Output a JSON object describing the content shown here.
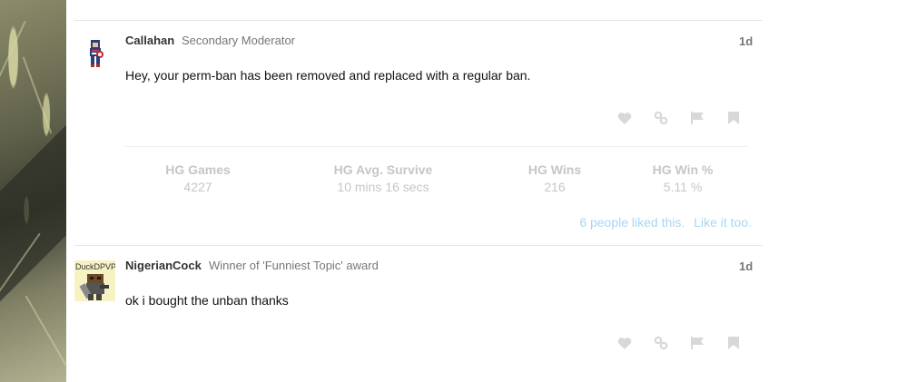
{
  "posts": [
    {
      "author": "Callahan",
      "user_title": "Secondary Moderator",
      "date": "1d",
      "body": "Hey, your perm-ban has been removed and replaced with a regular ban.",
      "stats": [
        {
          "label": "HG Games",
          "value": "4227"
        },
        {
          "label": "HG Avg. Survive",
          "value": "10 mins 16 secs"
        },
        {
          "label": "HG Wins",
          "value": "216"
        },
        {
          "label": "HG Win %",
          "value": "5.11 %"
        }
      ],
      "likes_text": "6 people liked this.",
      "like_action": "Like it too."
    },
    {
      "author": "NigerianCock",
      "user_title": "Winner of 'Funniest Topic' award",
      "date": "1d",
      "body": "ok i bought the unban thanks",
      "avatar_label": "DuckDPVP"
    }
  ],
  "icons": [
    "heart-icon",
    "link-icon",
    "flag-icon",
    "bookmark-icon"
  ],
  "colors": {
    "likes_link": "#a9d6ef",
    "stat_text": "#c6c6c6",
    "action_icon": "#d8d8d8",
    "divider": "#e6e6e6"
  }
}
